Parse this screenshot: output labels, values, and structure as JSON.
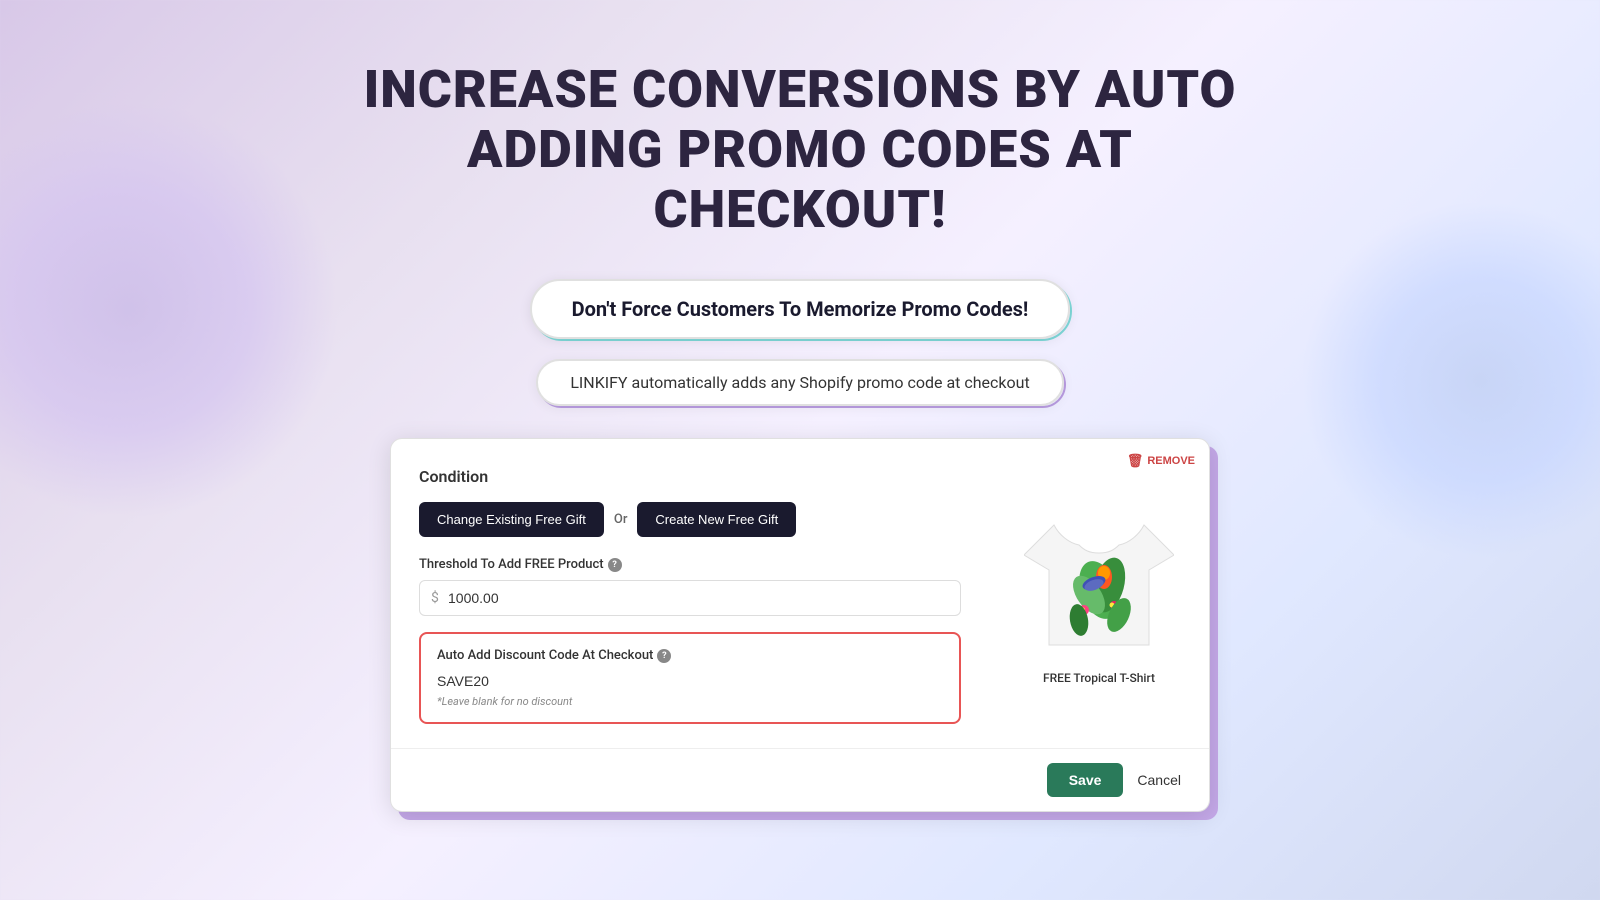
{
  "page": {
    "title_line1": "INCREASE CONVERSIONS BY AUTO",
    "title_line2": "ADDING PROMO CODES AT CHECKOUT!",
    "badge_large": "Don't Force Customers To Memorize Promo Codes!",
    "badge_small": "LINKIFY automatically adds any Shopify promo code at checkout"
  },
  "card": {
    "condition_label": "Condition",
    "btn_change_label": "Change Existing Free Gift",
    "or_label": "Or",
    "btn_create_label": "Create New Free Gift",
    "threshold_label": "Threshold To Add FREE Product",
    "threshold_value": "1000.00",
    "threshold_prefix": "$",
    "discount_label": "Auto Add Discount Code At Checkout",
    "discount_value": "SAVE20",
    "discount_hint": "*Leave blank for no discount",
    "product_name": "FREE Tropical T-Shirt",
    "remove_label": "REMOVE",
    "save_label": "Save",
    "cancel_label": "Cancel"
  }
}
